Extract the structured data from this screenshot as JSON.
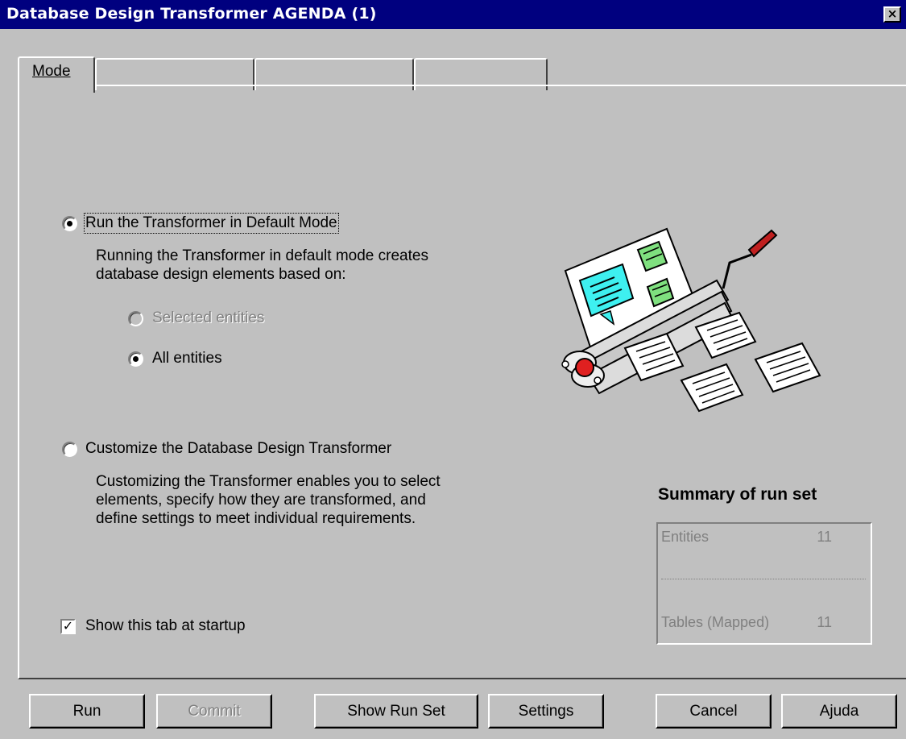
{
  "window": {
    "title": "Database Design Transformer AGENDA (1)",
    "close_glyph": "×"
  },
  "tabs": [
    {
      "label": "Mode",
      "active": true
    },
    {
      "label": "",
      "active": false
    },
    {
      "label": "",
      "active": false
    },
    {
      "label": "",
      "active": false
    }
  ],
  "mode": {
    "default_option": {
      "label": "Run the Transformer in Default Mode",
      "selected": true,
      "description_line1": "Running the Transformer in default mode creates",
      "description_line2": "database design elements based on:"
    },
    "scope": {
      "selected_entities": {
        "label": "Selected entities",
        "selected": false,
        "enabled": false
      },
      "all_entities": {
        "label": "All entities",
        "selected": true,
        "enabled": true
      }
    },
    "custom_option": {
      "label": "Customize the Database Design Transformer",
      "selected": false,
      "description_line1": "Customizing the Transformer enables you to select",
      "description_line2": "elements, specify how they are transformed, and",
      "description_line3": "define settings to meet individual requirements."
    },
    "show_tab_checkbox": {
      "label": "Show this tab at startup",
      "checked": true
    }
  },
  "summary": {
    "title": "Summary of run set",
    "rows": [
      {
        "label": "Entities",
        "value": "11"
      },
      {
        "label": "Tables (Mapped)",
        "value": "11"
      }
    ]
  },
  "buttons": {
    "run": "Run",
    "commit": "Commit",
    "show_run_set": "Show Run Set",
    "settings": "Settings",
    "cancel": "Cancel",
    "help": "Ajuda"
  },
  "illustration": {
    "icon": "transformer-machine-icon"
  },
  "colors": {
    "titlebar": "#00007f",
    "face": "#c0c0c0",
    "disabled_text": "#808080"
  }
}
